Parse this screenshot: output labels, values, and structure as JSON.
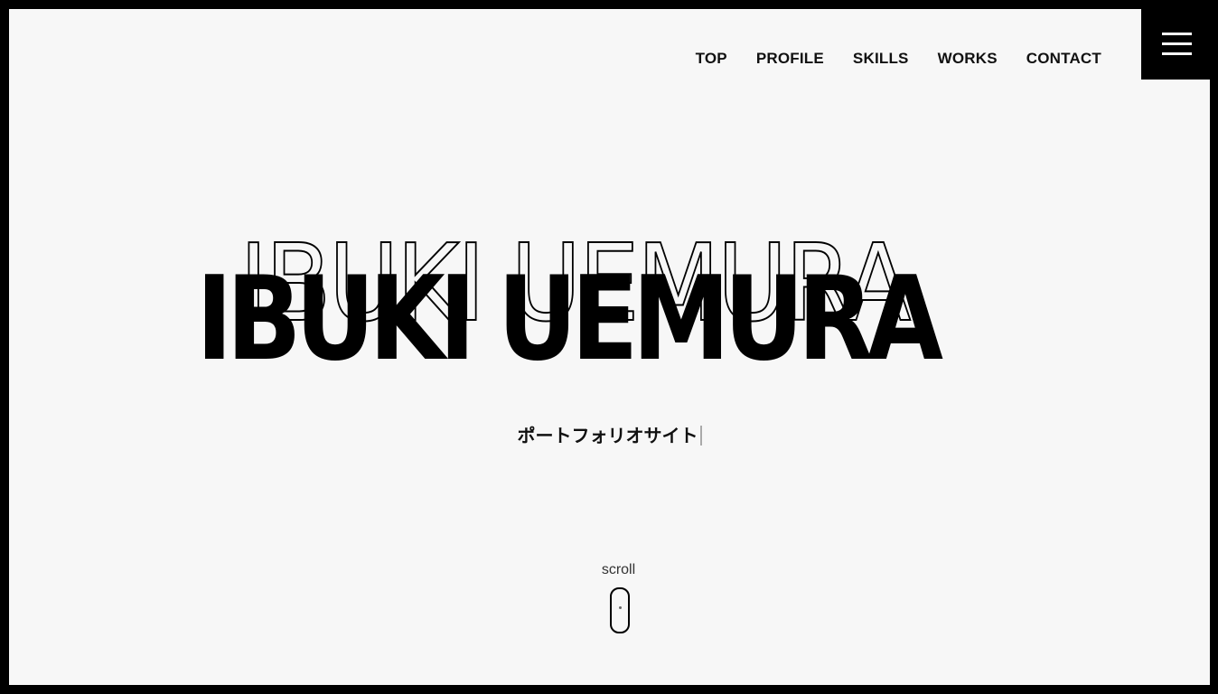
{
  "header": {
    "nav": [
      {
        "label": "TOP"
      },
      {
        "label": "PROFILE"
      },
      {
        "label": "SKILLS"
      },
      {
        "label": "WORKS"
      },
      {
        "label": "CONTACT"
      }
    ],
    "menu_icon": "hamburger-icon"
  },
  "hero": {
    "title": "IBUKI UEMURA",
    "subtitle": "ポートフォリオサイト"
  },
  "scroll": {
    "label": "scroll",
    "icon": "mouse-scroll-icon"
  },
  "colors": {
    "background": "#f7f7f7",
    "frame": "#000000",
    "text": "#111111"
  }
}
